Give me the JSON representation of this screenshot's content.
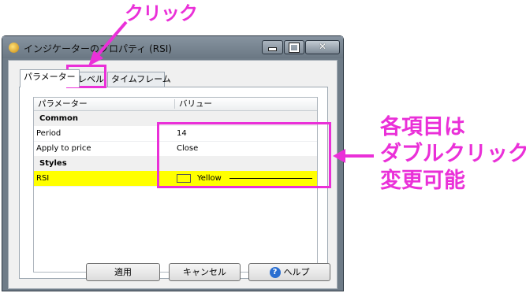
{
  "window": {
    "title": "インジケーターのプロパティ (RSI)",
    "controls": {
      "minimize": "▁",
      "maximize": "□",
      "close": "✕"
    }
  },
  "tabs": [
    {
      "label": "パラメーター",
      "active": true
    },
    {
      "label": "レベル",
      "active": false
    },
    {
      "label": "タイムフレーム",
      "active": false
    }
  ],
  "grid": {
    "headers": {
      "param": "パラメーター",
      "value": "バリュー"
    },
    "categories": {
      "common": "Common",
      "styles": "Styles"
    },
    "rows": {
      "period": {
        "name": "Period",
        "value": "14"
      },
      "apply": {
        "name": "Apply to price",
        "value": "Close"
      },
      "rsi": {
        "name": "RSI",
        "value": "Yellow",
        "color": "#ffff00"
      }
    }
  },
  "buttons": {
    "apply": "適用",
    "cancel": "キャンセル",
    "help": "ヘルプ",
    "help_icon": "?"
  },
  "annotations": {
    "click": "クリック",
    "note_line1": "各項目は",
    "note_line2": "ダブルクリックで",
    "note_line3": "変更可能",
    "color": "#ea30d8"
  }
}
